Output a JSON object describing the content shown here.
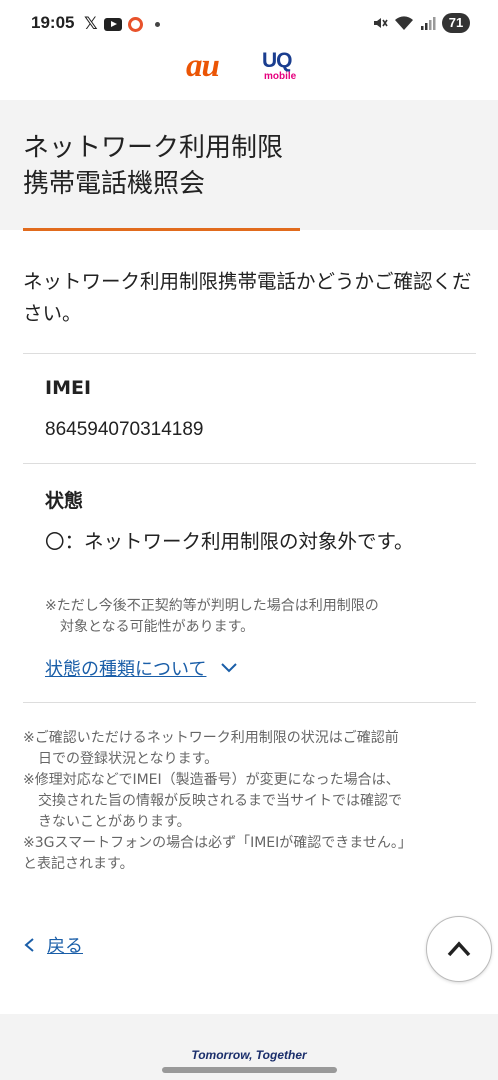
{
  "status_bar": {
    "time": "19:05",
    "x_glyph": "𝕏",
    "battery": "71",
    "icons": [
      "x-app-icon",
      "youtube-icon",
      "record-ring-icon",
      "notification-dot-icon",
      "mute-icon",
      "wifi-icon",
      "signal-icon",
      "battery-icon"
    ]
  },
  "brand": {
    "au_logo": "au",
    "uq_logo": "UQ",
    "uq_sub": "mobile",
    "colors": {
      "au": "#eb5505",
      "uq": "#1a3d8f",
      "mobile": "#e6007e"
    }
  },
  "page": {
    "title_line1": "ネットワーク利用制限",
    "title_line2": "携帯電話機照会",
    "intro": "ネットワーク利用制限携帯電話かどうかご確認ください。",
    "accent_color": "#e16b1d"
  },
  "imei": {
    "label": "IMEI",
    "value": "864594070314189"
  },
  "status": {
    "label": "状態",
    "result": "〇：ネットワーク利用制限の対象外です。",
    "note_line1": "※ただし今後不正契約等が判明した場合は利用制限の",
    "note_line2": "対象となる可能性があります。",
    "types_link": "状態の種類について"
  },
  "footer_notes": [
    {
      "first": "※ご確認いただけるネットワーク利用制限の状況はご確認前",
      "rest": [
        "日での登録状況となります。"
      ]
    },
    {
      "first": "※修理対応などでIMEI（製造番号）が変更になった場合は、",
      "rest": [
        "交換された旨の情報が反映されるまで当サイトでは確認で",
        "きないことがあります。"
      ]
    },
    {
      "first": "※3Gスマートフォンの場合は必ず「IMEIが確認できません。」",
      "rest": [
        "と表記されます。"
      ]
    }
  ],
  "navigation": {
    "back_label": "戻る",
    "scroll_top_icon": "chevron-up-icon"
  },
  "footer": {
    "tagline": "Tomorrow, Together"
  }
}
